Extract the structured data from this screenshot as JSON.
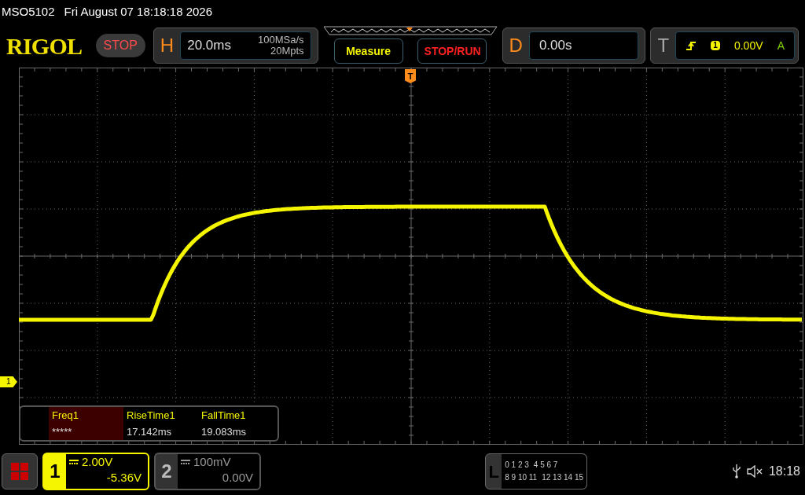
{
  "status_line": {
    "model": "MSO5102",
    "datetime": "Fri August 07 18:18:18 2026"
  },
  "header": {
    "logo": "RIGOL",
    "run_state": "STOP",
    "horizontal": {
      "label": "H",
      "timebase": "20.0ms",
      "sample_rate": "100MSa/s",
      "memory_depth": "20Mpts"
    },
    "buttons": [
      {
        "label": "Measure",
        "kind": "measure"
      },
      {
        "label": "STOP/RUN",
        "kind": "stoprun"
      }
    ],
    "delay": {
      "label": "D",
      "value": "0.00s"
    },
    "trigger": {
      "label": "T",
      "source": "1",
      "level": "0.00V",
      "mode": "A"
    }
  },
  "trigger_marker": "T",
  "channel_marker": "1",
  "measurements": [
    {
      "name": "Freq1",
      "value": "*****",
      "selected": true
    },
    {
      "name": "RiseTime1",
      "value": "17.142ms",
      "selected": false
    },
    {
      "name": "FallTime1",
      "value": "19.083ms",
      "selected": false
    }
  ],
  "channels": [
    {
      "number": "1",
      "scale": "2.00V",
      "offset": "-5.36V",
      "selected": true
    },
    {
      "number": "2",
      "scale": "100mV",
      "offset": "0.00V",
      "selected": false
    }
  ],
  "logic": {
    "label": "L",
    "rows": [
      [
        "0 1 2 3",
        "4 5 6 7"
      ],
      [
        "8 9 10 11",
        "12 13 14 15"
      ]
    ]
  },
  "clock": "18:18"
}
